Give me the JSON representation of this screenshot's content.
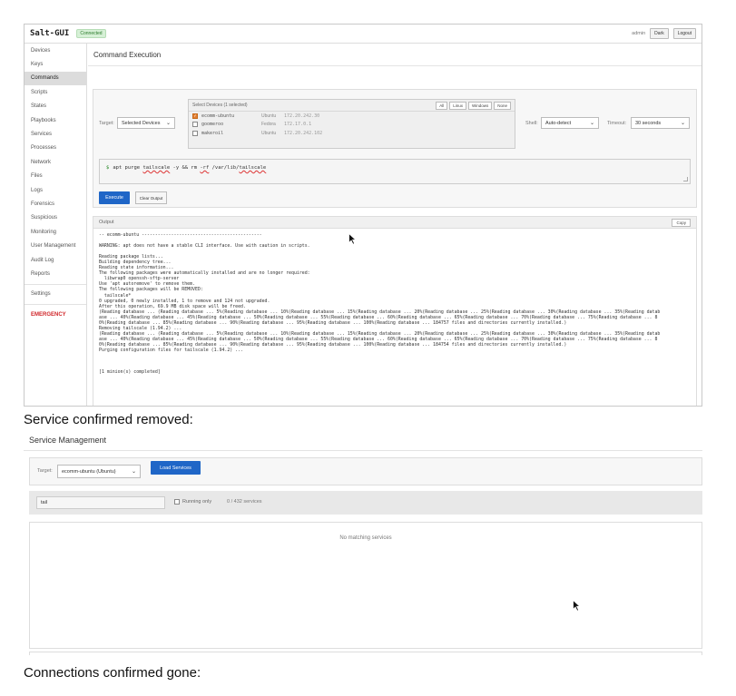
{
  "shot1": {
    "logo": "Salt-GUI",
    "connection_badge": "Connected",
    "user": "admin",
    "dark_btn": "Dark",
    "logout_btn": "Logout",
    "sidebar": [
      "Devices",
      "Keys",
      "Commands",
      "Scripts",
      "States",
      "Playbooks",
      "Services",
      "Processes",
      "Network",
      "Files",
      "Logs",
      "Forensics",
      "Suspicious",
      "Monitoring",
      "User Management",
      "Audit Log",
      "Reports"
    ],
    "sidebar_active": "Commands",
    "sidebar_settings": "Settings",
    "sidebar_emergency": "EMERGENCY",
    "page_title": "Command Execution",
    "target_label": "Target:",
    "target_value": "Selected Devices",
    "devices_title": "Select Devices (1 selected)",
    "device_filters": [
      "All",
      "Linux",
      "Windows",
      "None"
    ],
    "devices": [
      {
        "name": "ecomm-ubuntu",
        "os": "Ubuntu",
        "ip": "172.20.242.30",
        "checked": true
      },
      {
        "name": "goomeroo",
        "os": "Fedora",
        "ip": "172.17.0.1",
        "checked": false
      },
      {
        "name": "makeroil",
        "os": "Ubuntu",
        "ip": "172.20.242.102",
        "checked": false
      }
    ],
    "shell_label": "Shell:",
    "shell_value": "Auto-detect",
    "timeout_label": "Timeout:",
    "timeout_value": "30 seconds",
    "command_prompt": "$",
    "command_parts": [
      "apt purge ",
      "tailscale",
      " -y && rm ",
      "-rf",
      " /var/lib/",
      "tailscale"
    ],
    "execute_btn": "Execute",
    "clear_btn": "Clear Output",
    "output_title": "Output",
    "copy_btn": "Copy",
    "output_lines": [
      "-- ecomm-ubuntu ---------------------------------------------",
      "",
      "WARNING: apt does not have a stable CLI interface. Use with caution in scripts.",
      "",
      "Reading package lists...",
      "Building dependency tree...",
      "Reading state information...",
      "The following packages were automatically installed and are no longer required:",
      "  libwrap0 openssh-sftp-server",
      "Use 'apt autoremove' to remove them.",
      "The following packages will be REMOVED:",
      "  tailscale*",
      "0 upgraded, 0 newly installed, 1 to remove and 124 not upgraded.",
      "After this operation, 69.9 MB disk space will be freed.",
      "(Reading database ... (Reading database ... 5%(Reading database ... 10%(Reading database ... 15%(Reading database ... 20%(Reading database ... 25%(Reading database ... 30%(Reading database ... 35%(Reading datab",
      "ase ... 40%(Reading database ... 45%(Reading database ... 50%(Reading database ... 55%(Reading database ... 60%(Reading database ... 65%(Reading database ... 70%(Reading database ... 75%(Reading database ... 8",
      "0%(Reading database ... 85%(Reading database ... 90%(Reading database ... 95%(Reading database ... 100%(Reading database ... 184757 files and directories currently installed.)",
      "Removing tailscale (1.94.2) ...",
      "(Reading database ... (Reading database ... 5%(Reading database ... 10%(Reading database ... 15%(Reading database ... 20%(Reading database ... 25%(Reading database ... 30%(Reading database ... 35%(Reading datab",
      "ase ... 40%(Reading database ... 45%(Reading database ... 50%(Reading database ... 55%(Reading database ... 60%(Reading database ... 65%(Reading database ... 70%(Reading database ... 75%(Reading database ... 8",
      "0%(Reading database ... 85%(Reading database ... 90%(Reading database ... 95%(Reading database ... 100%(Reading database ... 184754 files and directories currently installed.)",
      "Purging configuration files for tailscale (1.94.2) ...",
      "",
      "",
      "",
      "[1 minion(s) completed]"
    ]
  },
  "caption1": "Service confirmed removed:",
  "shot2": {
    "title": "Service Management",
    "target_label": "Target:",
    "target_value": "ecomm-ubuntu (Ubuntu)",
    "load_btn": "Load Services",
    "filter_value": "tail",
    "running_only_label": "Running only",
    "service_count": "0 / 432 services",
    "empty_message": "No matching services"
  },
  "caption2": "Connections confirmed gone:",
  "colors": {
    "primary": "#1f66c7",
    "emergency": "#d0262a",
    "checkbox": "#e27d2f",
    "badge": "#d6f0d6"
  }
}
